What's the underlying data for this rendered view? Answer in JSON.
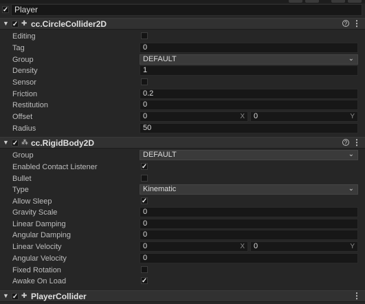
{
  "node": {
    "name": "Player",
    "enabled": true
  },
  "circle": {
    "title": "cc.CircleCollider2D",
    "enabled": true,
    "props": {
      "editing": {
        "label": "Editing",
        "checked": false
      },
      "tag": {
        "label": "Tag",
        "value": "0"
      },
      "group": {
        "label": "Group",
        "value": "DEFAULT"
      },
      "density": {
        "label": "Density",
        "value": "1"
      },
      "sensor": {
        "label": "Sensor",
        "checked": false
      },
      "friction": {
        "label": "Friction",
        "value": "0.2"
      },
      "restitution": {
        "label": "Restitution",
        "value": "0"
      },
      "offset": {
        "label": "Offset",
        "x": "0",
        "y": "0",
        "x_axis": "X",
        "y_axis": "Y"
      },
      "radius": {
        "label": "Radius",
        "value": "50"
      }
    }
  },
  "rigid": {
    "title": "cc.RigidBody2D",
    "enabled": true,
    "props": {
      "group": {
        "label": "Group",
        "value": "DEFAULT"
      },
      "contact": {
        "label": "Enabled Contact Listener",
        "checked": true
      },
      "bullet": {
        "label": "Bullet",
        "checked": false
      },
      "type": {
        "label": "Type",
        "value": "Kinematic"
      },
      "sleep": {
        "label": "Allow Sleep",
        "checked": true
      },
      "gravity": {
        "label": "Gravity Scale",
        "value": "0"
      },
      "lindamp": {
        "label": "Linear Damping",
        "value": "0"
      },
      "angdamp": {
        "label": "Angular Damping",
        "value": "0"
      },
      "linvel": {
        "label": "Linear Velocity",
        "x": "0",
        "y": "0",
        "x_axis": "X",
        "y_axis": "Y"
      },
      "angvel": {
        "label": "Angular Velocity",
        "value": "0"
      },
      "fixedrot": {
        "label": "Fixed Rotation",
        "checked": false
      },
      "awake": {
        "label": "Awake On Load",
        "checked": true
      }
    }
  },
  "player": {
    "title": "PlayerCollider",
    "enabled": true
  }
}
